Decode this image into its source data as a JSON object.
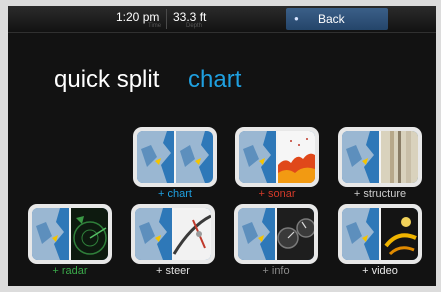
{
  "topbar": {
    "time": "1:20 pm",
    "time_sub": "Time",
    "depth": "33.3 ft",
    "depth_sub": "Depth",
    "back_label": "Back"
  },
  "title": {
    "part1": "quick split",
    "part2": "chart"
  },
  "tiles": [
    {
      "label": "+ chart",
      "label_color": "#1fa0e0",
      "icon": "chart-chart-icon"
    },
    {
      "label": "+ sonar",
      "label_color": "#d23a2a",
      "icon": "chart-sonar-icon"
    },
    {
      "label": "+ structure",
      "label_color": "#cfcfcf",
      "icon": "chart-structure-icon"
    },
    {
      "label": "+ radar",
      "label_color": "#3aa84a",
      "icon": "chart-radar-icon"
    },
    {
      "label": "+ steer",
      "label_color": "#e0e0e0",
      "icon": "chart-steer-icon"
    },
    {
      "label": "+ info",
      "label_color": "#8a8a8a",
      "icon": "chart-info-icon"
    },
    {
      "label": "+ video",
      "label_color": "#e8e8e8",
      "icon": "chart-video-icon"
    }
  ],
  "colors": {
    "accent": "#1fa0e0",
    "background": "#121212",
    "back_button": "#2d5a86"
  }
}
